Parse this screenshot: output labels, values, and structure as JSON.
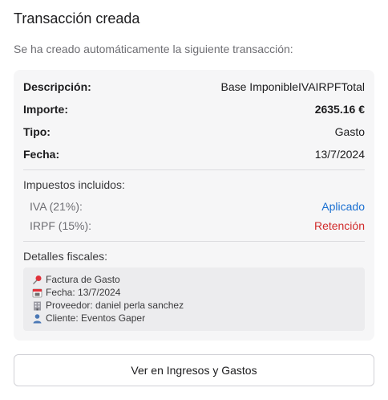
{
  "dialog": {
    "title": "Transacción creada",
    "subtitle": "Se ha creado automáticamente la siguiente transacción:"
  },
  "details": {
    "description_label": "Descripción:",
    "description_value": "Base ImponibleIVAIRPFTotal",
    "amount_label": "Importe:",
    "amount_value": "2635.16 €",
    "type_label": "Tipo:",
    "type_value": "Gasto",
    "date_label": "Fecha:",
    "date_value": "13/7/2024"
  },
  "taxes": {
    "heading": "Impuestos incluidos:",
    "items": [
      {
        "name": "IVA (21%):",
        "status": "Aplicado",
        "status_color": "#1a6fd1"
      },
      {
        "name": "IRPF (15%):",
        "status": "Retención",
        "status_color": "#d12b2b"
      }
    ]
  },
  "fiscal": {
    "heading": "Detalles fiscales:",
    "lines": [
      {
        "icon": "pushpin-icon",
        "text": "Factura de Gasto"
      },
      {
        "icon": "calendar-icon",
        "text": "Fecha: 13/7/2024"
      },
      {
        "icon": "office-building-icon",
        "text": "Proveedor: daniel perla sanchez"
      },
      {
        "icon": "person-icon",
        "text": "Cliente: Eventos Gaper"
      }
    ]
  },
  "actions": {
    "view_button_label": "Ver en Ingresos y Gastos"
  }
}
